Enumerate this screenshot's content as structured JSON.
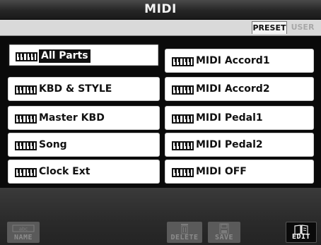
{
  "window": {
    "title": "MIDI"
  },
  "tabs": [
    {
      "label": "PRESET",
      "selected": true
    },
    {
      "label": "USER",
      "selected": false
    }
  ],
  "parts": [
    {
      "label": "All Parts",
      "selected": true,
      "icon": "midi-icon"
    },
    {
      "label": "KBD & STYLE",
      "selected": false,
      "icon": "midi-icon"
    },
    {
      "label": "Master KBD",
      "selected": false,
      "icon": "midi-icon"
    },
    {
      "label": "Song",
      "selected": false,
      "icon": "midi-icon"
    },
    {
      "label": "Clock Ext",
      "selected": false,
      "icon": "midi-icon"
    },
    {
      "label": "MIDI Accord1",
      "selected": false,
      "icon": "midi-icon"
    },
    {
      "label": "MIDI Accord2",
      "selected": false,
      "icon": "midi-icon"
    },
    {
      "label": "MIDI Pedal1",
      "selected": false,
      "icon": "midi-icon"
    },
    {
      "label": "MIDI Pedal2",
      "selected": false,
      "icon": "midi-icon"
    },
    {
      "label": "MIDI OFF",
      "selected": false,
      "icon": "midi-icon"
    }
  ],
  "functions": {
    "name": {
      "label": "NAME",
      "enabled": false,
      "icon": "name-icon"
    },
    "delete": {
      "label": "DELETE",
      "enabled": false,
      "icon": "trash-icon"
    },
    "save": {
      "label": "SAVE",
      "enabled": false,
      "icon": "floppy-disk-icon"
    },
    "edit": {
      "label": "EDIT",
      "enabled": true,
      "icon": "edit-book-icon"
    }
  },
  "colors": {
    "background": "#0a0a0a",
    "button_face": "#ffffff",
    "selected_highlight": "#111111",
    "disabled_button": "#5a5a5a"
  }
}
